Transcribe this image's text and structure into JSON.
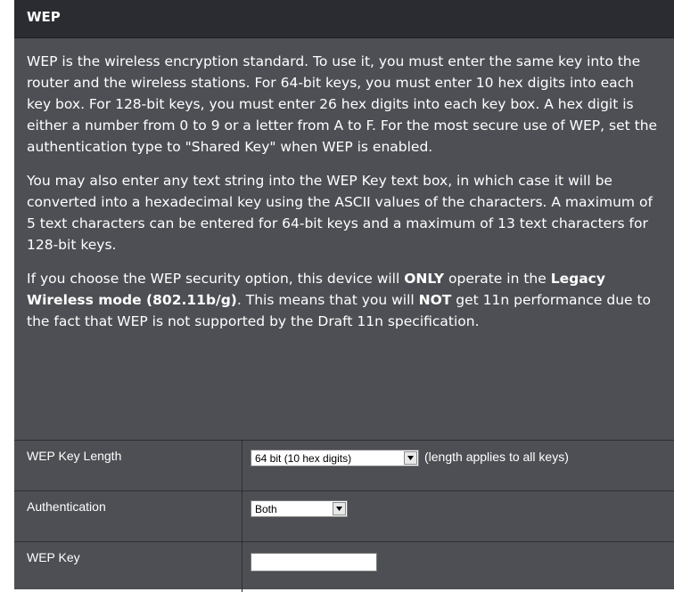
{
  "section": {
    "title": "WEP"
  },
  "description": {
    "p1": "WEP is the wireless encryption standard. To use it, you must enter the same key into the router and the wireless stations. For 64-bit keys, you must enter 10 hex digits into each key box. For 128-bit keys, you must enter 26 hex digits into each key box. A hex digit is either a number from 0 to 9 or a letter from A to F. For the most secure use of WEP, set the authentication type to \"Shared Key\" when WEP is enabled.",
    "p2": "You may also enter any text string into the WEP Key text box, in which case it will be converted into a hexadecimal key using the ASCII values of the characters. A maximum of 5 text characters can be entered for 64-bit keys and a maximum of 13 text characters for 128-bit keys.",
    "p3": {
      "a": "If you choose the WEP security option, this device will ",
      "b": "ONLY",
      "c": " operate in the ",
      "d": "Legacy Wireless mode (802.11b/g)",
      "e": ". This means that you will ",
      "f": "NOT",
      "g": " get 11n performance due to the fact that WEP is not supported by the Draft 11n specification."
    }
  },
  "fields": {
    "key_length": {
      "label": "WEP Key Length",
      "selected": "64 bit (10 hex digits)",
      "note": "(length applies to all keys)"
    },
    "authentication": {
      "label": "Authentication",
      "selected": "Both"
    },
    "wep_key": {
      "label": "WEP Key",
      "value": ""
    }
  },
  "colors": {
    "panel_bg": "#4d4f54",
    "header_bg": "#2b2c31",
    "text": "#ffffff"
  }
}
